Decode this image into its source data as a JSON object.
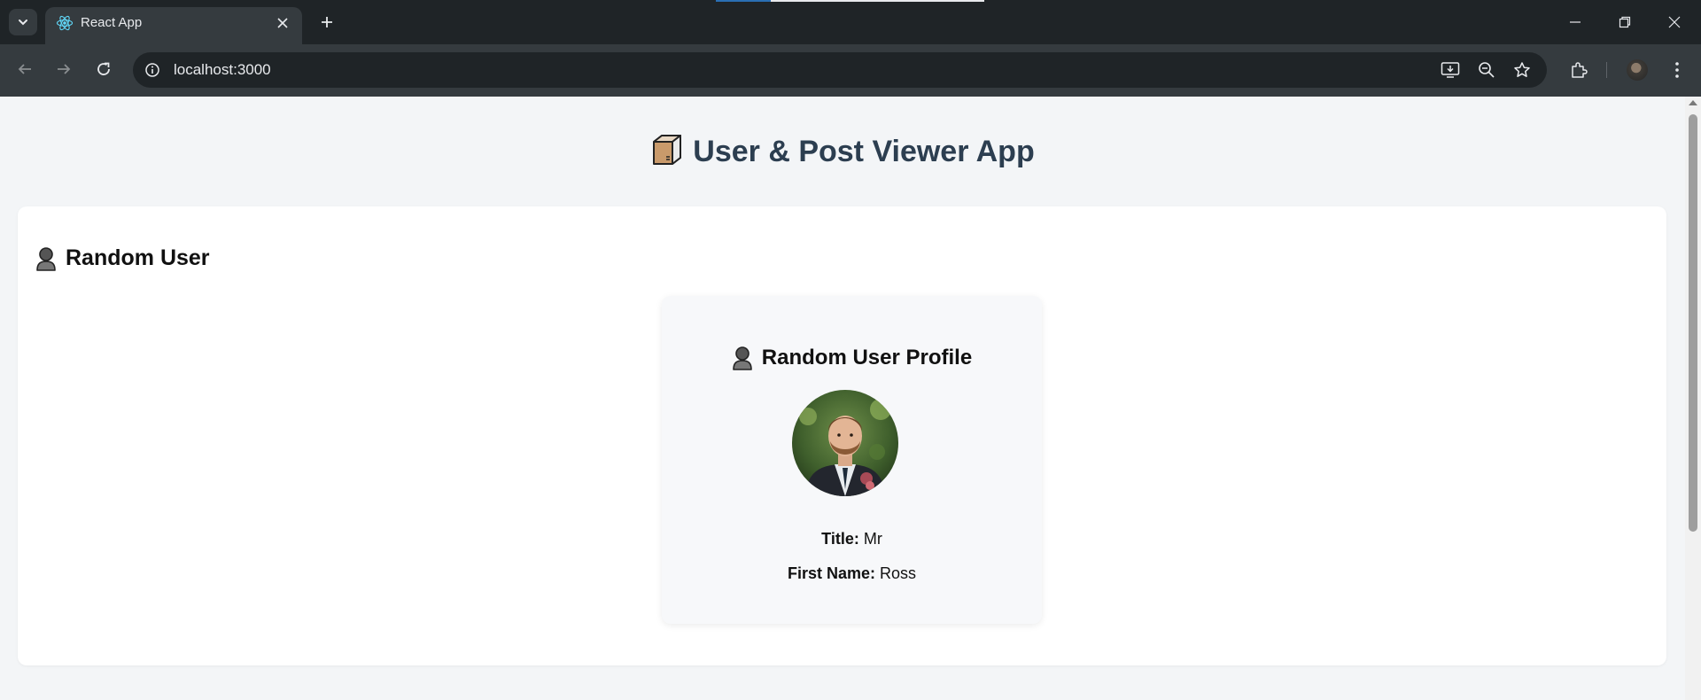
{
  "browser": {
    "tab": {
      "title": "React App",
      "favicon": "react-logo-icon"
    },
    "address_bar": {
      "url": "localhost:3000"
    },
    "toolbar_icons": [
      "back-arrow-icon",
      "forward-arrow-icon",
      "reload-icon",
      "site-info-icon",
      "install-app-icon",
      "zoom-out-icon",
      "bookmark-star-icon",
      "extensions-icon",
      "profile-avatar",
      "more-menu-icon"
    ],
    "colors": {
      "chrome_dark": "#1f2427",
      "chrome_toolbar": "#353b3f",
      "chrome_text": "#e8eaed"
    }
  },
  "page": {
    "title": "User & Post Viewer App",
    "title_icon": "package-box-icon",
    "colors": {
      "background": "#f3f5f7",
      "title": "#2c3e50",
      "card": "#ffffff",
      "profile_card": "#f7f8fa"
    }
  },
  "random_user_section": {
    "heading": "Random User",
    "heading_icon": "person-silhouette-icon",
    "profile_card": {
      "heading": "Random User Profile",
      "heading_icon": "person-silhouette-icon",
      "photo": "user-portrait-photo",
      "fields": [
        {
          "label": "Title:",
          "value": "Mr"
        },
        {
          "label": "First Name:",
          "value": "Ross"
        }
      ]
    }
  }
}
